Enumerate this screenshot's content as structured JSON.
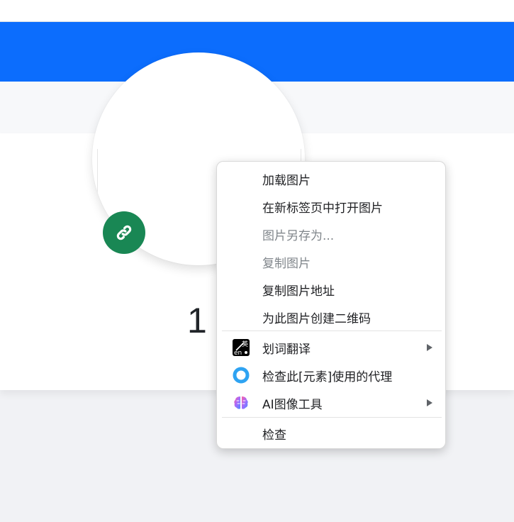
{
  "page": {
    "number_display": "1"
  },
  "colors": {
    "header_blue": "#0c6dfd",
    "badge_green": "#198754"
  },
  "context_menu": {
    "items": [
      {
        "label": "加载图片",
        "enabled": true
      },
      {
        "label": "在新标签页中打开图片",
        "enabled": true
      },
      {
        "label": "图片另存为...",
        "enabled": false
      },
      {
        "label": "复制图片",
        "enabled": false
      },
      {
        "label": "复制图片地址",
        "enabled": true
      },
      {
        "label": "为此图片创建二维码",
        "enabled": true
      },
      {
        "label": "划词翻译",
        "icon": "translate-extension-icon",
        "submenu": true
      },
      {
        "label": "检查此[元素]使用的代理",
        "icon": "proxy-ring-icon",
        "submenu": false
      },
      {
        "label": "AI图像工具",
        "icon": "ai-brain-icon",
        "submenu": true
      },
      {
        "label": "检查",
        "enabled": true
      }
    ]
  }
}
